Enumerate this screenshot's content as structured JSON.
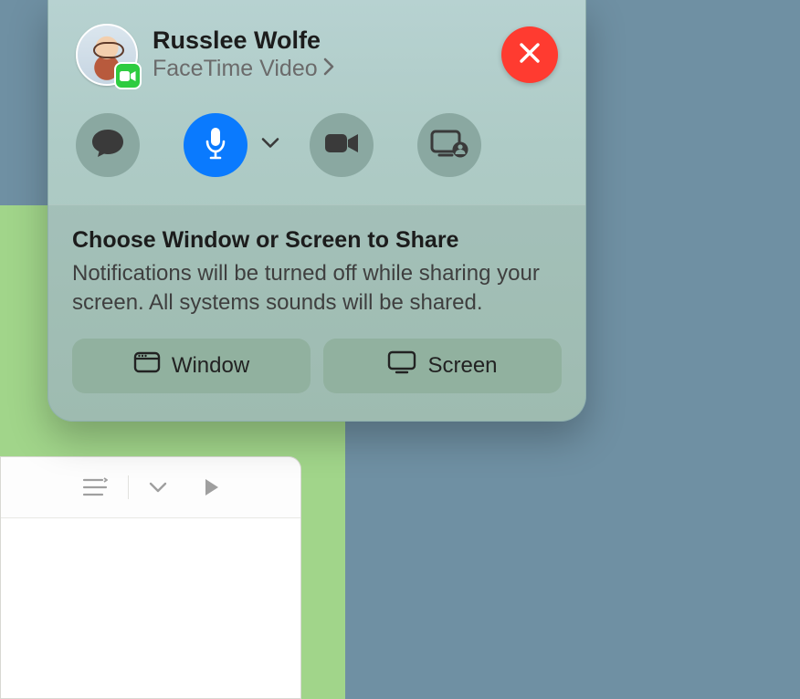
{
  "facetime": {
    "contact_name": "Russlee Wolfe",
    "call_type": "FaceTime Video",
    "share_section": {
      "title": "Choose Window or Screen to Share",
      "description": "Notifications will be turned off while sharing your screen. All systems sounds will be shared.",
      "window_button": "Window",
      "screen_button": "Screen"
    }
  }
}
